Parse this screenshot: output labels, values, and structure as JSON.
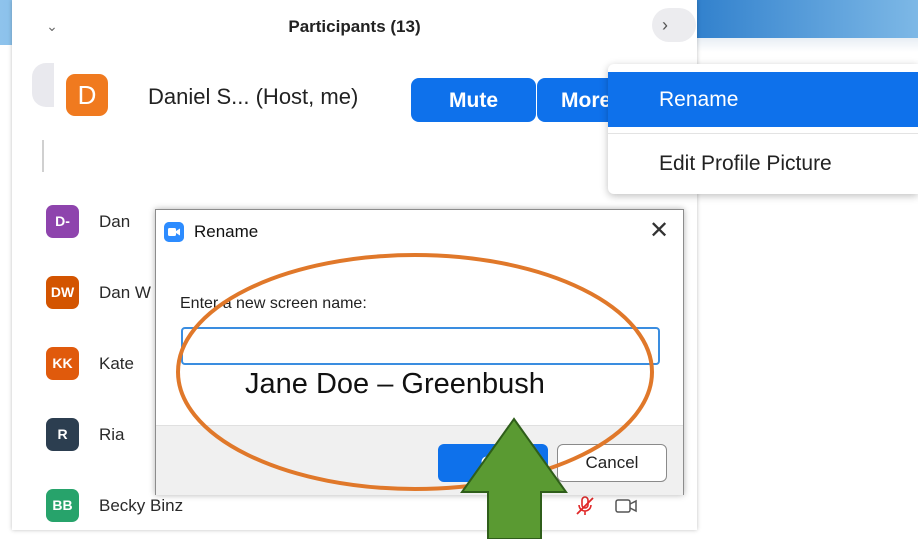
{
  "panel": {
    "title": "Participants (13)",
    "collapse_icon": "chevron-down-icon",
    "host": {
      "initial": "D",
      "avatar_color": "#f07a1f",
      "name": "Daniel S... (Host, me)",
      "mute_label": "Mute",
      "more_label": "More"
    },
    "participants": [
      {
        "initials": "D-",
        "color": "#8e44ad",
        "name": "Dan"
      },
      {
        "initials": "DW",
        "color": "#d35400",
        "name": "Dan W"
      },
      {
        "initials": "KK",
        "color": "#e05a0c",
        "name": "Kate"
      },
      {
        "initials": "R",
        "color": "#2c3e50",
        "name": "Ria"
      },
      {
        "initials": "BB",
        "color": "#27a36b",
        "name": "Becky Binz"
      }
    ]
  },
  "context_menu": {
    "items": [
      "Rename",
      "Edit Profile Picture"
    ],
    "highlight_color": "#0e71eb"
  },
  "dialog": {
    "title": "Rename",
    "close_icon": "close-icon",
    "field_label": "Enter a new screen name:",
    "input_value": "",
    "ok_label": "OK",
    "cancel_label": "Cancel"
  },
  "annotation": {
    "text": "Jane Doe – Greenbush",
    "ellipse_color": "#e0782a",
    "arrow_color": "#5a9a32"
  }
}
